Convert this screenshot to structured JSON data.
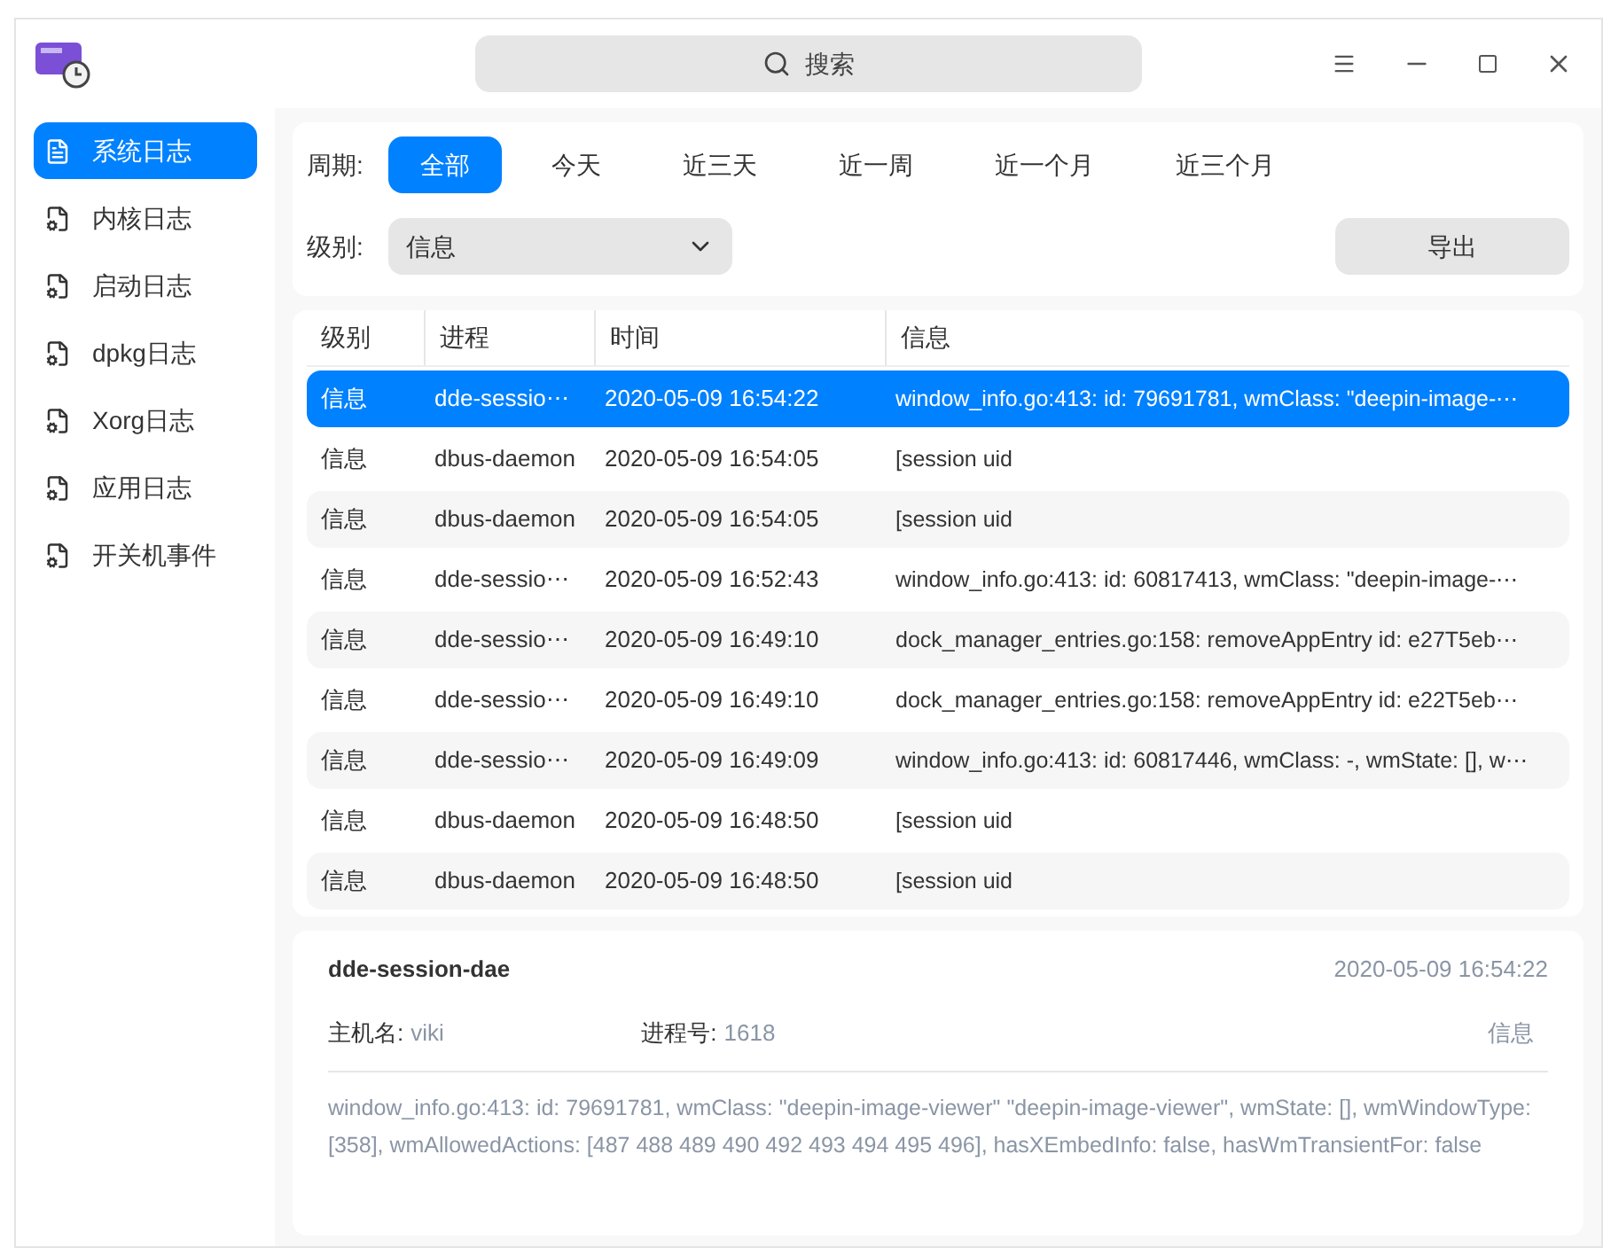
{
  "titlebar": {
    "search": {
      "placeholder": "搜索"
    }
  },
  "sidebar": {
    "items": [
      {
        "label": "系统日志",
        "selected": true
      },
      {
        "label": "内核日志",
        "selected": false
      },
      {
        "label": "启动日志",
        "selected": false
      },
      {
        "label": "dpkg日志",
        "selected": false
      },
      {
        "label": "Xorg日志",
        "selected": false
      },
      {
        "label": "应用日志",
        "selected": false
      },
      {
        "label": "开关机事件",
        "selected": false
      }
    ]
  },
  "filters": {
    "period_label": "周期:",
    "periods": [
      {
        "label": "全部",
        "selected": true
      },
      {
        "label": "今天",
        "selected": false
      },
      {
        "label": "近三天",
        "selected": false
      },
      {
        "label": "近一周",
        "selected": false
      },
      {
        "label": "近一个月",
        "selected": false
      },
      {
        "label": "近三个月",
        "selected": false
      }
    ],
    "level_label": "级别:",
    "level_value": "信息",
    "export_button": "导出"
  },
  "table": {
    "columns": [
      "级别",
      "进程",
      "时间",
      "信息"
    ],
    "rows": [
      {
        "level": "信息",
        "process": "dde-sessio⋯",
        "time": "2020-05-09 16:54:22",
        "message": "window_info.go:413: id: 79691781, wmClass: \"deepin-image-⋯",
        "selected": true
      },
      {
        "level": "信息",
        "process": "dbus-daemon",
        "time": "2020-05-09 16:54:05",
        "message": "[session uid",
        "selected": false
      },
      {
        "level": "信息",
        "process": "dbus-daemon",
        "time": "2020-05-09 16:54:05",
        "message": "[session uid",
        "selected": false
      },
      {
        "level": "信息",
        "process": "dde-sessio⋯",
        "time": "2020-05-09 16:52:43",
        "message": "window_info.go:413: id: 60817413, wmClass: \"deepin-image-⋯",
        "selected": false
      },
      {
        "level": "信息",
        "process": "dde-sessio⋯",
        "time": "2020-05-09 16:49:10",
        "message": "dock_manager_entries.go:158: removeAppEntry id: e27T5eb⋯",
        "selected": false
      },
      {
        "level": "信息",
        "process": "dde-sessio⋯",
        "time": "2020-05-09 16:49:10",
        "message": "dock_manager_entries.go:158: removeAppEntry id: e22T5eb⋯",
        "selected": false
      },
      {
        "level": "信息",
        "process": "dde-sessio⋯",
        "time": "2020-05-09 16:49:09",
        "message": "window_info.go:413: id: 60817446, wmClass: -, wmState: [], w⋯",
        "selected": false
      },
      {
        "level": "信息",
        "process": "dbus-daemon",
        "time": "2020-05-09 16:48:50",
        "message": "[session uid",
        "selected": false
      },
      {
        "level": "信息",
        "process": "dbus-daemon",
        "time": "2020-05-09 16:48:50",
        "message": "[session uid",
        "selected": false
      }
    ]
  },
  "detail": {
    "process": "dde-session-dae",
    "time": "2020-05-09 16:54:22",
    "host_label": "主机名:",
    "host": "viki",
    "pid_label": "进程号:",
    "pid": "1618",
    "level": "信息",
    "message": "window_info.go:413: id: 79691781, wmClass: \"deepin-image-viewer\" \"deepin-image-viewer\", wmState: [], wmWindowType: [358], wmAllowedActions: [487 488 489 490 492 493 494 495 496], hasXEmbedInfo: false, hasWmTransientFor: false"
  }
}
